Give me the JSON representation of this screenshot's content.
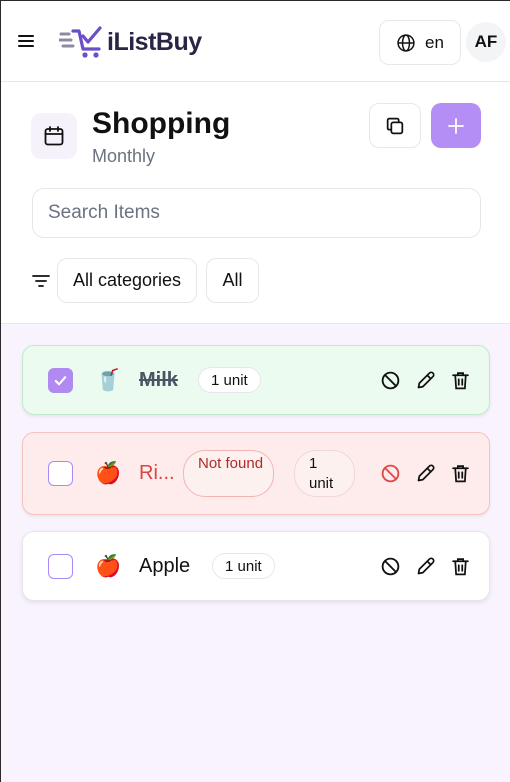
{
  "header": {
    "brand": "iListBuy",
    "language": "en",
    "avatar_initials": "AF"
  },
  "list": {
    "title": "Shopping",
    "subtitle": "Monthly"
  },
  "search": {
    "placeholder": "Search Items",
    "value": ""
  },
  "filters": {
    "category": "All categories",
    "status": "All"
  },
  "items": [
    {
      "name": "Milk",
      "emoji": "🥤",
      "quantity": "1 unit",
      "checked": true,
      "status": "bought"
    },
    {
      "name": "Ri...",
      "emoji": "🍎",
      "quantity": "1 unit",
      "checked": false,
      "status": "not-found",
      "badge": "Not found"
    },
    {
      "name": "Apple",
      "emoji": "🍎",
      "quantity": "1 unit",
      "checked": false,
      "status": "pending"
    }
  ],
  "icons": {
    "menu": "hamburger-icon",
    "language": "globe-icon",
    "list": "calendar-icon",
    "copy": "copy-icon",
    "add": "plus-icon",
    "filter": "filter-icon",
    "block": "block-icon",
    "edit": "pencil-icon",
    "delete": "trash-icon"
  },
  "colors": {
    "accent": "#b48ef5",
    "bought_bg": "#ebfbf0",
    "not_found_bg": "#fdeceb",
    "not_found_text": "#dc4343",
    "list_bg": "#f8f3fd"
  }
}
